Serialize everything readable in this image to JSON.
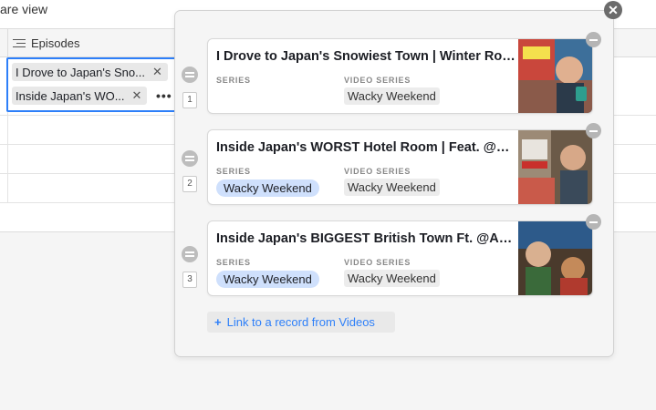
{
  "topbar": {
    "view_label": "are view"
  },
  "grid": {
    "column_header": "Episodes"
  },
  "active_cell": {
    "chips": [
      {
        "label": "I Drove to Japan's Sno...",
        "remove": "✕"
      },
      {
        "label": "Inside Japan's WO...",
        "remove": "✕"
      }
    ],
    "more": "•••"
  },
  "popup": {
    "close": "✕",
    "field_labels": {
      "series": "SERIES",
      "video_series": "VIDEO SERIES"
    },
    "records": [
      {
        "index": "1",
        "title": "I Drove to Japan's Snowiest Town | Winter Road Trip",
        "series": "",
        "video_series": "Wacky Weekend"
      },
      {
        "index": "2",
        "title": "Inside Japan's WORST Hotel Room | Feat. @CDawgVA",
        "series": "Wacky Weekend",
        "video_series": "Wacky Weekend"
      },
      {
        "index": "3",
        "title": "Inside Japan's BIGGEST British Town Ft. @Abroad in Japan",
        "series": "Wacky Weekend",
        "video_series": "Wacky Weekend"
      }
    ],
    "link_button": {
      "plus": "+",
      "label": "Link to a record from Videos"
    }
  },
  "colors": {
    "accent": "#2d7ff9",
    "series_pill": "#cfe0fc"
  },
  "icons": {
    "column_type": "lines-icon",
    "drag": "drag-handle-icon",
    "remove": "minus-circle-icon"
  }
}
